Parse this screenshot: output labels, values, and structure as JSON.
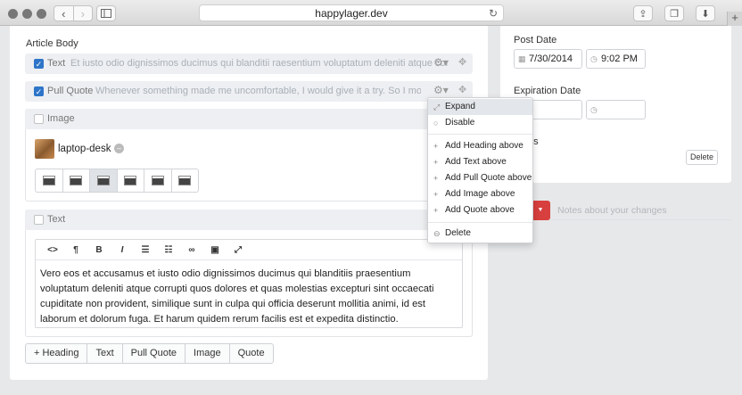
{
  "browser": {
    "url": "happylager.dev",
    "reload_icon": "reload-icon",
    "back_glyph": "‹",
    "forward_glyph": "›",
    "share_glyph": "⇪",
    "tabs_glyph": "❐",
    "download_glyph": "⬇",
    "newtab_glyph": "+"
  },
  "main": {
    "section_label": "Article Body",
    "blocks": [
      {
        "type": "Text",
        "preview": "Et iusto odio dignissimos ducimus qui blanditii raesentium voluptatum deleniti atque corr..."
      },
      {
        "type": "Pull Quote",
        "preview": "Whenever something made me uncomfortable, I would give it a try. So I moved ar..."
      }
    ],
    "image_block": {
      "type": "Image",
      "asset": "laptop-desk",
      "remove_glyph": "–"
    },
    "text_block": {
      "type": "Text",
      "body": "Vero eos et accusamus et iusto odio dignissimos ducimus qui blanditiis praesentium voluptatum deleniti atque corrupti quos dolores et quas molestias excepturi sint occaecati cupiditate non provident, similique sunt in culpa qui officia deserunt mollitia animi, id est laborum et dolorum fuga. Et harum quidem rerum facilis est et expedita distinctio."
    },
    "toolbar": {
      "code": "<>",
      "para": "¶",
      "bold": "B",
      "italic": "I",
      "ul": "☰",
      "ol": "☷",
      "link": "∞",
      "image": "▣",
      "full": "⤢"
    },
    "add_buttons": {
      "heading": "+ Heading",
      "text": "Text",
      "pullquote": "Pull Quote",
      "image": "Image",
      "quote": "Quote"
    }
  },
  "context_menu": {
    "items": [
      {
        "label": "Expand",
        "icon": "expand-icon",
        "glyph": "⤢"
      },
      {
        "label": "Disable",
        "icon": "circle-icon",
        "glyph": "○"
      },
      {
        "label": "Add Heading above",
        "icon": "plus-icon",
        "glyph": "+"
      },
      {
        "label": "Add Text above",
        "icon": "plus-icon",
        "glyph": "+"
      },
      {
        "label": "Add Pull Quote above",
        "icon": "plus-icon",
        "glyph": "+"
      },
      {
        "label": "Add Image above",
        "icon": "plus-icon",
        "glyph": "+"
      },
      {
        "label": "Add Quote above",
        "icon": "plus-icon",
        "glyph": "+"
      },
      {
        "label": "Delete",
        "icon": "minus-circle-icon",
        "glyph": "⊖"
      }
    ]
  },
  "sidebar": {
    "post_date_label": "Post Date",
    "post_date": "7/30/2014",
    "post_time": "9:02 PM",
    "expiration_label": "Expiration Date",
    "enabled_partial": "us",
    "delete_button": "Delete",
    "notes_placeholder": "Notes about your changes"
  },
  "colors": {
    "accent": "#2e75c9",
    "danger": "#d7403e"
  }
}
